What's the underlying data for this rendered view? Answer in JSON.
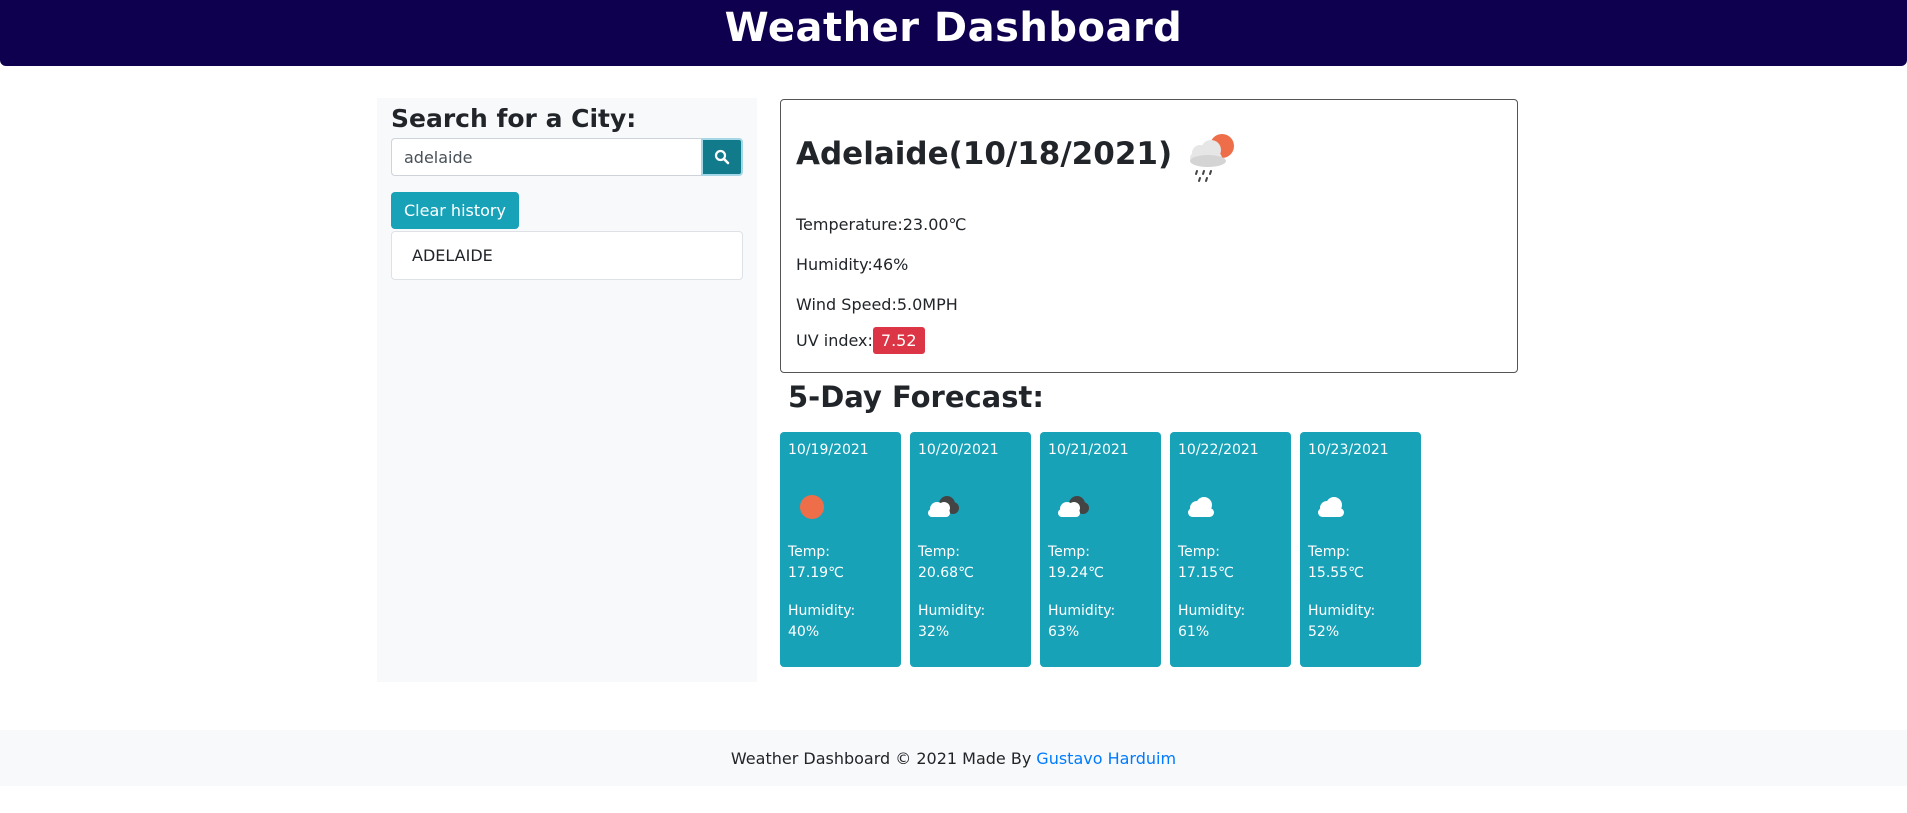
{
  "header": {
    "title": "Weather Dashboard"
  },
  "sidebar": {
    "heading": "Search for a City:",
    "search": {
      "value": "adelaide",
      "icon": "search-icon"
    },
    "clear_label": "Clear history",
    "history": [
      "ADELAIDE"
    ]
  },
  "current": {
    "title": "Adelaide(10/18/2021)",
    "icon": "sun-rain-cloud-icon",
    "temperature_label": "Temperature:",
    "temperature": "23.00℃",
    "humidity_label": "Humidity:",
    "humidity": "46%",
    "wind_label": "Wind Speed:",
    "wind": "5.0MPH",
    "uv_label": "UV index:",
    "uv": "7.52",
    "uv_color": "#dc3545"
  },
  "forecast": {
    "title": "5-Day Forecast:",
    "temp_label": "Temp:",
    "humidity_label": "Humidity:",
    "days": [
      {
        "date": "10/19/2021",
        "icon": "sun-icon",
        "temp": "17.19℃",
        "humidity": "40%"
      },
      {
        "date": "10/20/2021",
        "icon": "broken-clouds-icon",
        "temp": "20.68℃",
        "humidity": "32%"
      },
      {
        "date": "10/21/2021",
        "icon": "broken-clouds-icon",
        "temp": "19.24℃",
        "humidity": "63%"
      },
      {
        "date": "10/22/2021",
        "icon": "cloud-icon",
        "temp": "17.15℃",
        "humidity": "61%"
      },
      {
        "date": "10/23/2021",
        "icon": "cloud-icon",
        "temp": "15.55℃",
        "humidity": "52%"
      }
    ]
  },
  "footer": {
    "text": "Weather Dashboard © 2021 Made By",
    "link": "Gustavo Harduim",
    "link_color": "#007bff"
  },
  "colors": {
    "header": "#0f004f",
    "card": "#17a2b8",
    "search_button": "#117a8b"
  }
}
